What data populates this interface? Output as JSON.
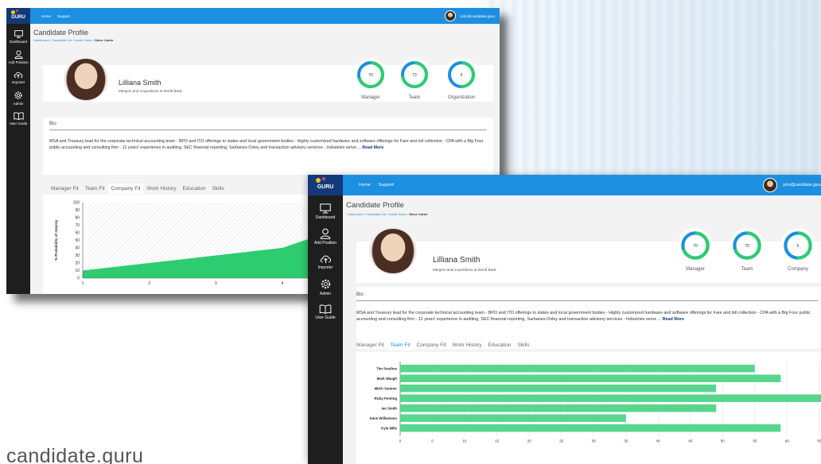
{
  "brand_caption": "candidate.guru",
  "app": {
    "logo_text": "GURU",
    "nav": [
      "Home",
      "Support"
    ],
    "user_email": "john@candidate.guru",
    "sidebar": [
      {
        "label": "Dashboard",
        "icon": "monitor-icon"
      },
      {
        "label": "Add Position",
        "icon": "user-add-icon"
      },
      {
        "label": "Importer",
        "icon": "cloud-upload-icon"
      },
      {
        "label": "Admin",
        "icon": "gear-icon"
      },
      {
        "label": "User Guide",
        "icon": "book-icon"
      }
    ],
    "page_title": "Candidate Profile",
    "breadcrumb": [
      "Dashboard",
      "Candidate List",
      "Inside Sales",
      "Steve Carter"
    ],
    "breadcrumb_separator": "/",
    "profile": {
      "name": "Lilliana Smith",
      "company": "Mergers and Acquisitions at World Bank"
    },
    "bio": {
      "heading": "Bio",
      "text": "MSA and Treasury lead for the corporate technical accounting team - BPO and ITO offerings to states and local government bodies - Highly customized hardware and software offerings for Fare and toll collection - CPA with a Big Four public accounting and consulting firm - 12 years' experience in auditing, SEC financial reporting, Sarbanes-Oxley and transaction advisory services - Industries serve ...",
      "read_more": "Read More"
    },
    "tabs": [
      "Manager Fit",
      "Team Fit",
      "Company Fit",
      "Work History",
      "Education",
      "Skills"
    ]
  },
  "windows": [
    {
      "scores": [
        {
          "label": "Manager",
          "value": "70"
        },
        {
          "label": "Team",
          "value": "73"
        },
        {
          "label": "Organization",
          "value": "5"
        }
      ],
      "active_tab": 2
    },
    {
      "scores": [
        {
          "label": "Manager",
          "value": "70"
        },
        {
          "label": "Team",
          "value": "70"
        },
        {
          "label": "Company",
          "value": "5"
        }
      ],
      "active_tab": 1
    }
  ],
  "colors": {
    "topbar": "#1d8fe1",
    "sidebar": "#1e1e1e",
    "accent_green": "#2ecc71",
    "bar_green": "#58d68d",
    "ring_blue": "#1d8fe1",
    "link_navy": "#123a7a"
  },
  "chart_data": [
    {
      "type": "area",
      "x": [
        1,
        2,
        3,
        4,
        5,
        6,
        7
      ],
      "series": [
        {
          "values": [
            10,
            20,
            30,
            40,
            70,
            80,
            85
          ]
        }
      ],
      "xlabel": "Years",
      "ylabel": "% Probability of staying",
      "xticks": [
        "1",
        "2",
        "3",
        "4",
        "5",
        "6"
      ],
      "yticks": [
        "0",
        "10",
        "20",
        "30",
        "40",
        "50",
        "60",
        "70",
        "80",
        "90",
        "100"
      ],
      "ylim": [
        0,
        100
      ],
      "grid": "hatched background"
    },
    {
      "type": "bar",
      "orientation": "horizontal",
      "categories": [
        "Tim Southee",
        "Mark Waugh",
        "Mitch Santner",
        "Ricky Ponting",
        "Ian Smith",
        "Kane Williamson",
        "Kyle Mills"
      ],
      "values": [
        55,
        59,
        49,
        66,
        49,
        35,
        59
      ],
      "xticks": [
        "0",
        "5",
        "10",
        "15",
        "20",
        "25",
        "30",
        "35",
        "40",
        "45",
        "50",
        "55",
        "60",
        "65"
      ],
      "xlim": [
        0,
        66
      ],
      "grid": "vertical gridlines"
    }
  ]
}
